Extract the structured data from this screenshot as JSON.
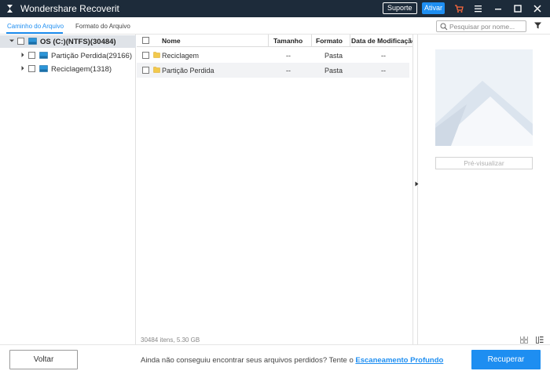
{
  "window": {
    "title": "Wondershare Recoverit",
    "suporte_label": "Suporte",
    "ativar_label": "Ativar",
    "icons": [
      "app-logo-icon",
      "cart-icon",
      "menu-icon",
      "minimize-icon",
      "maximize-icon",
      "close-icon"
    ]
  },
  "tabs": [
    {
      "label": "Caminho do Arquivo",
      "active": true
    },
    {
      "label": "Formato do Arquivo",
      "active": false
    }
  ],
  "search": {
    "placeholder": "Pesquisar por nome..."
  },
  "tree": [
    {
      "label": "OS (C:)(NTFS)(30484)",
      "level": 0,
      "expanded": true,
      "selected": true
    },
    {
      "label": "Partição Perdida(29166)",
      "level": 1,
      "expanded": false
    },
    {
      "label": "Reciclagem(1318)",
      "level": 1,
      "expanded": false
    }
  ],
  "table": {
    "headers": {
      "name": "Nome",
      "size": "Tamanho",
      "format": "Formato",
      "date": "Data de Modificação"
    },
    "rows": [
      {
        "name": "Reciclagem",
        "size": "--",
        "format": "Pasta",
        "date": "--"
      },
      {
        "name": "Partição Perdida",
        "size": "--",
        "format": "Pasta",
        "date": "--"
      }
    ]
  },
  "status": {
    "text": "30484 itens, 5.30 GB"
  },
  "preview": {
    "button_label": "Pré-visualizar"
  },
  "bottom": {
    "back_label": "Voltar",
    "message": "Ainda não conseguiu encontrar seus arquivos perdidos? Tente o ",
    "deep_scan_label": "Escaneamento Profundo",
    "recover_label": "Recuperar"
  },
  "colors": {
    "titlebar": "#1d2b3a",
    "accent": "#1e8ef1"
  }
}
